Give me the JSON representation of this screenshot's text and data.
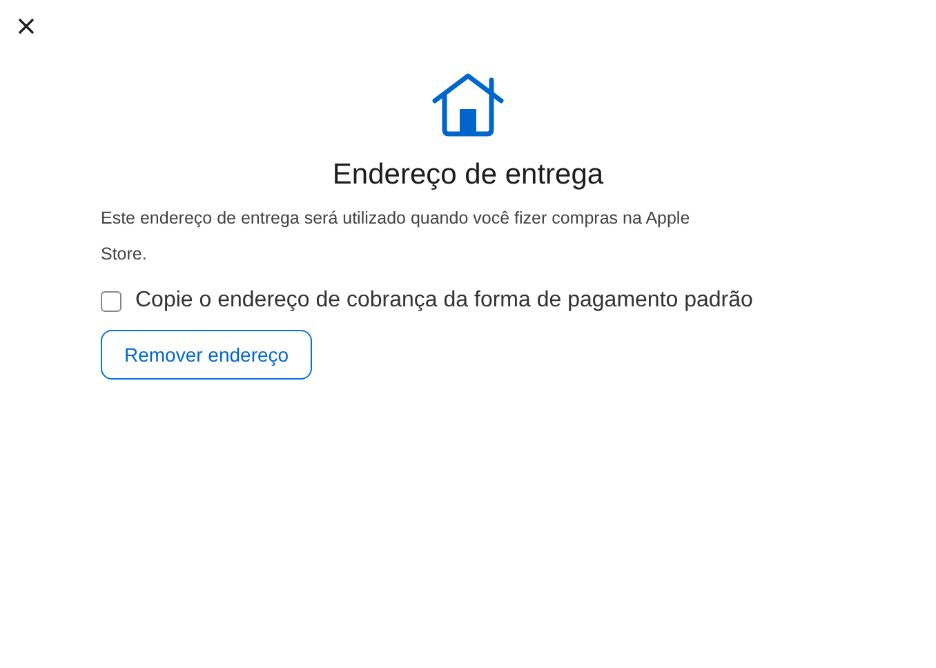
{
  "title": "Endereço de entrega",
  "description": "Este endereço de entrega será utilizado quando você fizer compras na Apple Store.",
  "checkbox": {
    "label": "Copie o endereço de cobrança da forma de pagamento padrão",
    "checked": false
  },
  "button": "Remover endereço"
}
